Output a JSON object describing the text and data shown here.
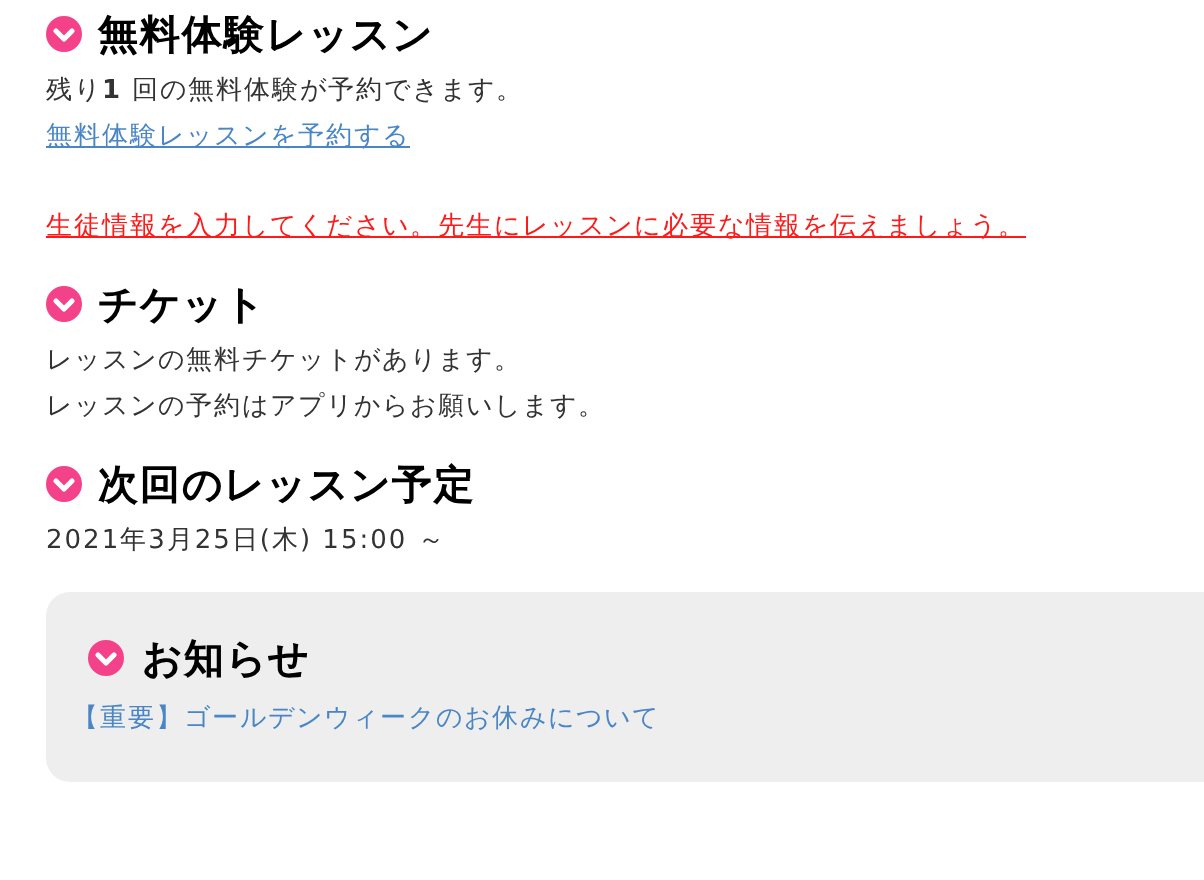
{
  "sections": [
    {
      "title": "無料体験レッスン",
      "lines": [
        {
          "kind": "text",
          "text": "残り**1** 回の無料体験が予約できます。"
        },
        {
          "kind": "link",
          "text": "無料体験レッスンを予約する"
        },
        {
          "kind": "alert",
          "text": "生徒情報を入力してください。先生にレッスンに必要な情報を伝えましょう。"
        }
      ]
    },
    {
      "title": "チケット",
      "lines": [
        {
          "kind": "text",
          "text": "レッスンの無料チケットがあります。"
        },
        {
          "kind": "text",
          "text": "レッスンの予約はアプリからお願いします。"
        }
      ]
    },
    {
      "title": "次回のレッスン予定",
      "lines": [
        {
          "kind": "text",
          "text": "2021年3月25日(木) 15:00 ～"
        }
      ]
    }
  ],
  "notice": {
    "title": "お知らせ",
    "items": [
      "【重要】ゴールデンウィークのお休みについて"
    ]
  }
}
